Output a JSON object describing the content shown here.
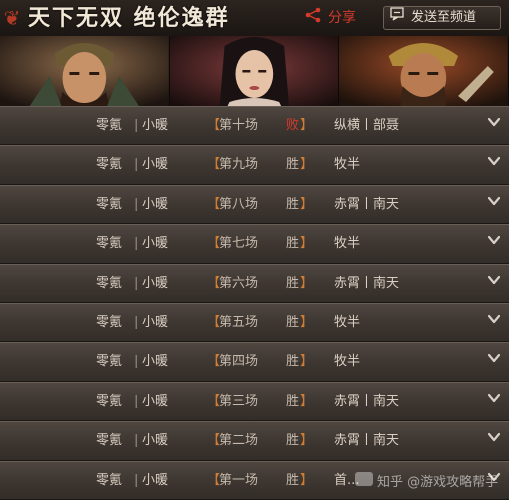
{
  "header": {
    "title": "天下无双  绝伦逸群",
    "share_label": "分享",
    "share_icon": "share-icon",
    "send_label": "发送至频道",
    "send_icon": "send-icon"
  },
  "banner": {
    "heroes": [
      "warrior-portrait-left",
      "woman-portrait-center",
      "warrior-portrait-right"
    ]
  },
  "matches": [
    {
      "player1": "零氪",
      "player2": "小暖",
      "round": "第十场",
      "result": "败",
      "opponent": "纵横丨部聂"
    },
    {
      "player1": "零氪",
      "player2": "小暖",
      "round": "第九场",
      "result": "胜",
      "opponent": "牧半"
    },
    {
      "player1": "零氪",
      "player2": "小暖",
      "round": "第八场",
      "result": "胜",
      "opponent": "赤霄丨南天"
    },
    {
      "player1": "零氪",
      "player2": "小暖",
      "round": "第七场",
      "result": "胜",
      "opponent": "牧半"
    },
    {
      "player1": "零氪",
      "player2": "小暖",
      "round": "第六场",
      "result": "胜",
      "opponent": "赤霄丨南天"
    },
    {
      "player1": "零氪",
      "player2": "小暖",
      "round": "第五场",
      "result": "胜",
      "opponent": "牧半"
    },
    {
      "player1": "零氪",
      "player2": "小暖",
      "round": "第四场",
      "result": "胜",
      "opponent": "牧半"
    },
    {
      "player1": "零氪",
      "player2": "小暖",
      "round": "第三场",
      "result": "胜",
      "opponent": "赤霄丨南天"
    },
    {
      "player1": "零氪",
      "player2": "小暖",
      "round": "第二场",
      "result": "胜",
      "opponent": "赤霄丨南天"
    },
    {
      "player1": "零氪",
      "player2": "小暖",
      "round": "第一场",
      "result": "胜",
      "opponent": "首..."
    }
  ],
  "separator": "|",
  "bracket_open": "【",
  "bracket_close": "】",
  "watermark": "知乎 @游戏攻略帮手",
  "colors": {
    "lose": "#d63a2c",
    "accent_bracket": "#d07e34",
    "share": "#d53b2c"
  }
}
